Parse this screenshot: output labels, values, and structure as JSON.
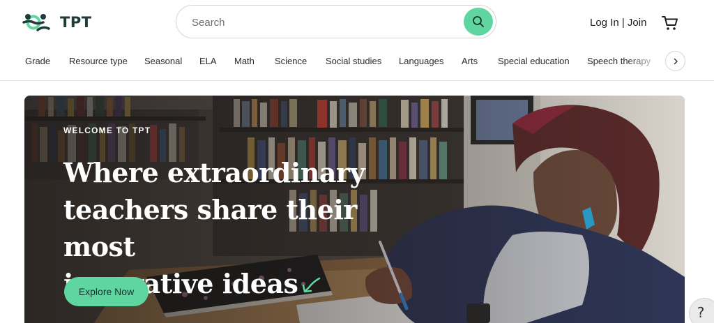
{
  "brand": {
    "name": "TPT",
    "accent_color": "#5fd6a0",
    "logo_color": "#1e3b3a"
  },
  "search": {
    "placeholder": "Search",
    "value": "",
    "button_icon": "search-icon"
  },
  "account": {
    "login_join_label": "Log In | Join",
    "cart_icon": "cart-icon"
  },
  "nav": {
    "items": [
      {
        "label": "Grade"
      },
      {
        "label": "Resource type"
      },
      {
        "label": "Seasonal"
      },
      {
        "label": "ELA"
      },
      {
        "label": "Math"
      },
      {
        "label": "Science"
      },
      {
        "label": "Social studies"
      },
      {
        "label": "Languages"
      },
      {
        "label": "Arts"
      },
      {
        "label": "Special education"
      },
      {
        "label": "Speech therapy"
      }
    ],
    "next_icon": "chevron-right-icon"
  },
  "hero": {
    "eyebrow": "WELCOME TO TPT",
    "title_line1": "Where extraordinary",
    "title_line2": "teachers share their most",
    "title_line3": "innovative ideas",
    "cta_label": "Explore Now",
    "image_description_icon": "teacher-writing-photo"
  },
  "help": {
    "label": "?"
  }
}
